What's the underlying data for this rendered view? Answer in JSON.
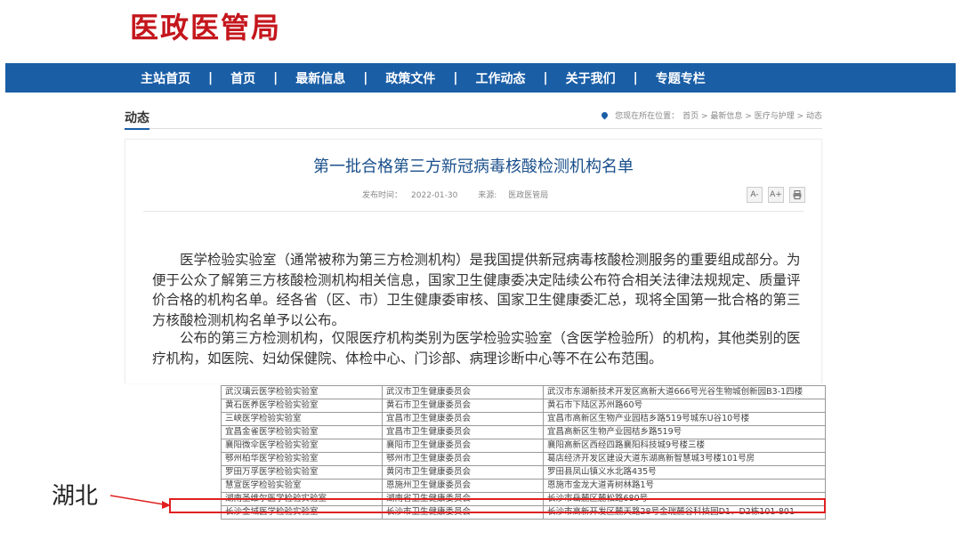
{
  "site": {
    "logo_text": "医政医管局"
  },
  "nav": {
    "items": [
      "主站首页",
      "首页",
      "最新信息",
      "政策文件",
      "工作动态",
      "关于我们",
      "专题专栏"
    ],
    "separator": "|"
  },
  "breadcrumb_bar": {
    "section_title": "动态",
    "location_prefix": "您现在所在位置：",
    "crumbs": [
      "首页",
      "最新信息",
      "医疗与护理",
      "动态"
    ],
    "separator": ">"
  },
  "article": {
    "title": "第一批合格第三方新冠病毒核酸检测机构名单",
    "publish_label": "发布时间：",
    "publish_date": "2022-01-30",
    "source_label": "来源:",
    "source": "医政医管局",
    "tools": [
      "A-",
      "A+",
      "print"
    ],
    "paragraphs": [
      "医学检验实验室（通常被称为第三方检测机构）是我国提供新冠病毒核酸检测服务的重要组成部分。为便于公众了解第三方核酸检测机构相关信息，国家卫生健康委决定陆续公布符合相关法律法规规定、质量评价合格的机构名单。经各省（区、市）卫生健康委审核、国家卫生健康委汇总，现将全国第一批合格的第三方核酸检测机构名单予以公布。",
      "公布的第三方检测机构，仅限医疗机构类别为医学检验实验室（含医学检验所）的机构，其他类别的医疗机构，如医院、妇幼保健院、体检中心、门诊部、病理诊断中心等不在公布范围。"
    ]
  },
  "table": {
    "rows": [
      [
        "武汉璃云医学检验实验室",
        "武汉市卫生健康委员会",
        "武汉市东湖新技术开发区高新大道666号光谷生物城创新园B3-1四楼"
      ],
      [
        "黄石医养医学检验实验室",
        "黄石市卫生健康委员会",
        "黄石市下陆区苏州路60号"
      ],
      [
        "三峡医学检验实验室",
        "宜昌市卫生健康委员会",
        "宜昌市高新区生物产业园桔乡路519号城东U谷10号楼"
      ],
      [
        "宜昌金雀医学检验实验室",
        "宜昌市卫生健康委员会",
        "宜昌高新区生物产业园桔乡路519号"
      ],
      [
        "襄阳微伞医学检验实验室",
        "襄阳市卫生健康委员会",
        "襄阳高新区西经四路襄阳科技城9号楼三楼"
      ],
      [
        "鄂州柏华医学检验实验室",
        "鄂州市卫生健康委员会",
        "葛店经济开发区建设大道东湖高新智慧城3号楼101号房"
      ],
      [
        "罗田万孚医学检验实验室",
        "黄冈市卫生健康委员会",
        "罗田县凤山镇义水北路435号"
      ],
      [
        "慧宣医学检验实验室",
        "恩施州卫生健康委员会",
        "恩施市金龙大道青树林路1号"
      ],
      [
        "湖南圣维尔医学检验实验室",
        "湖南省卫生健康委员会",
        "长沙市岳麓区麓松路680号"
      ],
      [
        "长沙金域医学检验实验室",
        "长沙市卫生健康委员会",
        "长沙市高新开发区麓天路28号金瑞麓谷科技园D1、D2栋101-801"
      ]
    ]
  },
  "annotation": {
    "label": "湖北",
    "highlight_color": "#e02020"
  }
}
